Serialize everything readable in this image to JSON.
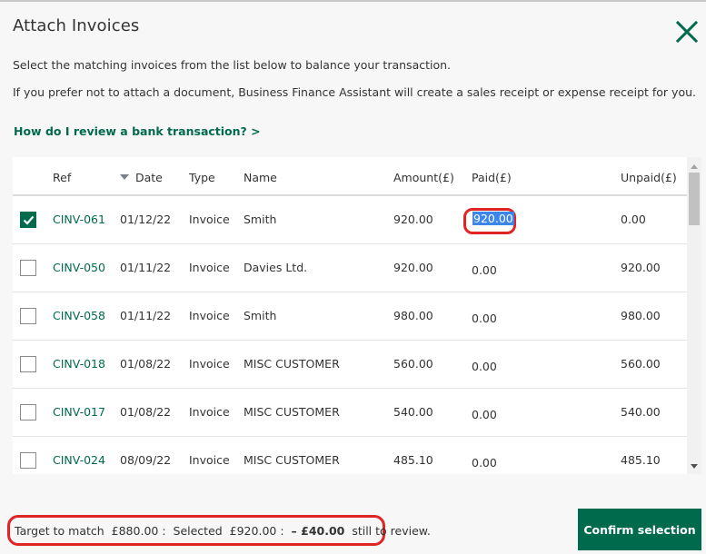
{
  "dialog": {
    "title": "Attach Invoices",
    "description_1": "Select the matching invoices from the list below to balance your transaction.",
    "description_2": "If you prefer not to attach a document, Business Finance Assistant will create a sales receipt or expense receipt for you.",
    "help_link": "How do I review a bank transaction? >",
    "close_icon": "close-icon"
  },
  "table": {
    "columns": {
      "ref": "Ref",
      "date": "Date",
      "type": "Type",
      "name": "Name",
      "amount": "Amount(£)",
      "paid": "Paid(£)",
      "unpaid": "Unpaid(£)"
    },
    "sort": {
      "column": "date",
      "direction": "descending",
      "icon": "sort-down-icon"
    },
    "rows": [
      {
        "checked": true,
        "ref": "CINV-061",
        "date": "01/12/22",
        "type": "Invoice",
        "name": "Smith",
        "amount": "920.00",
        "paid": "920.00",
        "unpaid": "0.00",
        "paid_selected": true
      },
      {
        "checked": false,
        "ref": "CINV-050",
        "date": "01/11/22",
        "type": "Invoice",
        "name": "Davies Ltd.",
        "amount": "920.00",
        "paid": "0.00",
        "unpaid": "920.00"
      },
      {
        "checked": false,
        "ref": "CINV-058",
        "date": "01/11/22",
        "type": "Invoice",
        "name": "Smith",
        "amount": "980.00",
        "paid": "0.00",
        "unpaid": "980.00"
      },
      {
        "checked": false,
        "ref": "CINV-018",
        "date": "01/08/22",
        "type": "Invoice",
        "name": "MISC CUSTOMER",
        "amount": "560.00",
        "paid": "0.00",
        "unpaid": "560.00"
      },
      {
        "checked": false,
        "ref": "CINV-017",
        "date": "01/08/22",
        "type": "Invoice",
        "name": "MISC CUSTOMER",
        "amount": "540.00",
        "paid": "0.00",
        "unpaid": "540.00"
      },
      {
        "checked": false,
        "ref": "CINV-024",
        "date": "08/09/22",
        "type": "Invoice",
        "name": "MISC CUSTOMER",
        "amount": "485.10",
        "paid": "0.00",
        "unpaid": "485.10"
      }
    ]
  },
  "footer": {
    "target_label": "Target to match",
    "target_value": "£880.00",
    "sep": ":",
    "selected_label": "Selected",
    "selected_value": "£920.00",
    "difference_value": "– £40.00",
    "difference_label": "still to review.",
    "confirm_label": "Confirm selection"
  },
  "colors": {
    "brand": "#006a4d",
    "highlight_ring": "#e02424",
    "selection": "#3b86e8"
  }
}
